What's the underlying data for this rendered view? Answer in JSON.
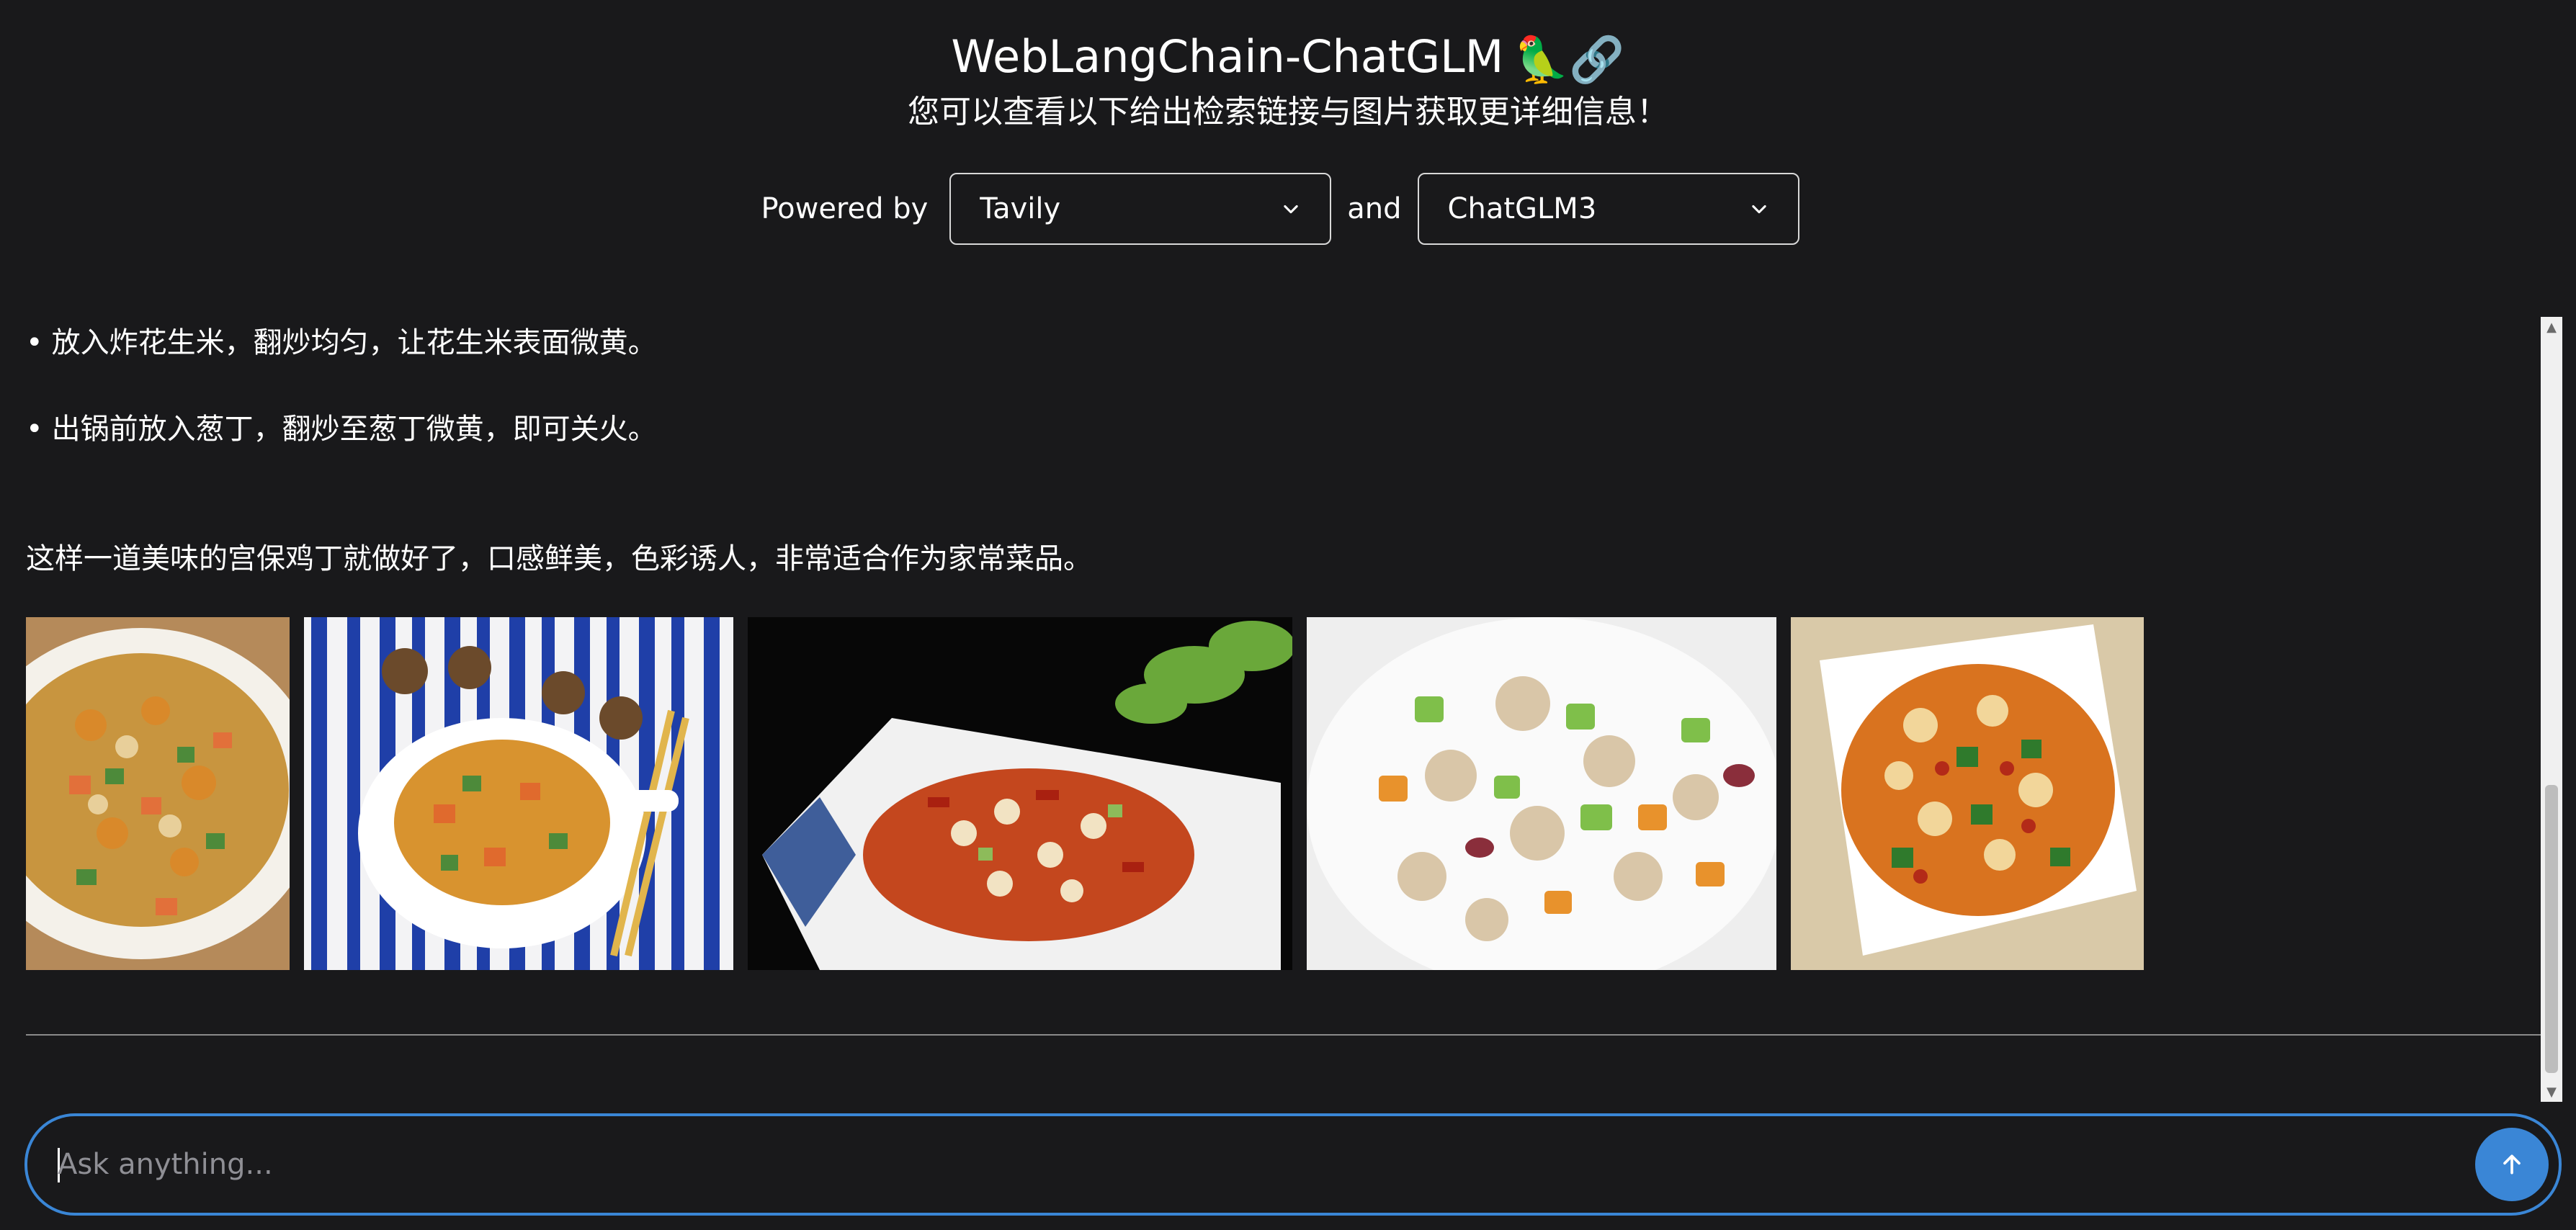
{
  "header": {
    "title": "WebLangChain-ChatGLM",
    "title_emoji": "🦜🔗",
    "subtitle": "您可以查看以下给出检索链接与图片获取更详细信息！",
    "powered_by_label": "Powered by",
    "and_label": "and",
    "retriever_select": {
      "selected": "Tavily"
    },
    "llm_select": {
      "selected": "ChatGLM3"
    }
  },
  "messages": {
    "bullet1": "放入炸花生米，翻炒均匀，让花生米表面微黄。",
    "bullet2": "出锅前放入葱丁，翻炒至葱丁微黄，即可关火。",
    "summary": "这样一道美味的宫保鸡丁就做好了，口感鲜美，色彩诱人，非常适合作为家常菜品。"
  },
  "images": [
    {
      "name": "kung-pao-chicken-photo-1"
    },
    {
      "name": "kung-pao-chicken-photo-2"
    },
    {
      "name": "kung-pao-chicken-photo-3"
    },
    {
      "name": "kung-pao-chicken-photo-4"
    },
    {
      "name": "kung-pao-chicken-photo-5"
    }
  ],
  "input": {
    "placeholder": "Ask anything...",
    "value": ""
  },
  "icons": {
    "chevron": "chevron-down-icon",
    "send": "arrow-up-icon"
  },
  "colors": {
    "background": "#19191b",
    "accent": "#3a86d6",
    "text": "#ffffff"
  }
}
